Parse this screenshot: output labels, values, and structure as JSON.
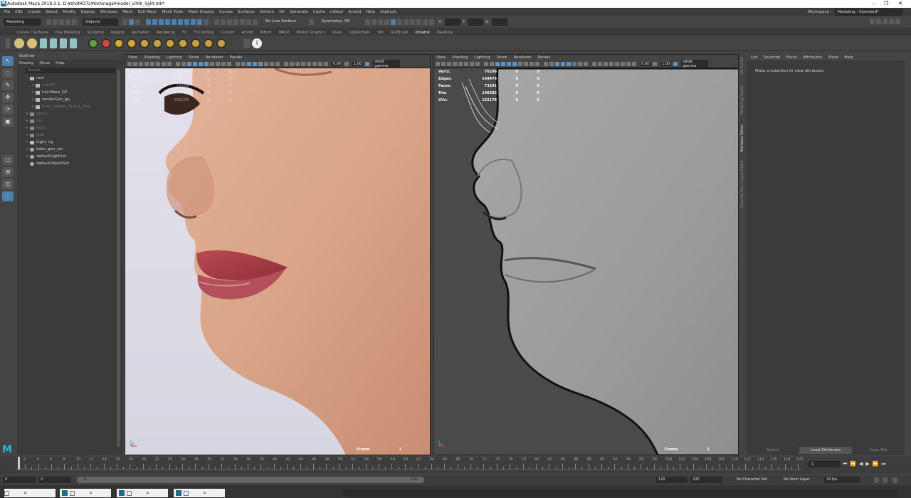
{
  "window": {
    "title": "Autodesk Maya 2019.3.1: D:¥shot¥DTL¥tominaga¥model_v006_light.mb*",
    "logo_letter": "M",
    "controls": [
      "–",
      "❐",
      "✕"
    ]
  },
  "menubar": {
    "items": [
      "File",
      "Edit",
      "Create",
      "Select",
      "Modify",
      "Display",
      "Windows",
      "Mesh",
      "Edit Mesh",
      "Mesh Tools",
      "Mesh Display",
      "Curves",
      "Surfaces",
      "Deform",
      "UV",
      "Generate",
      "Cache",
      "mGear",
      "Arnold",
      "Help",
      "chptools"
    ],
    "workspace_label": "Workspace :",
    "workspace_value": "Modeling - Standard*"
  },
  "statusline": {
    "mode": "Modeling",
    "objects": "Objects",
    "live_surface": "No Live Surface",
    "symmetry": "Symmetry: Off",
    "x_label": "X:",
    "y_label": "Y:",
    "z_label": "Z:"
  },
  "shelf": {
    "tabs": [
      "Curves / Surfaces",
      "Poly Modeling",
      "Sculpting",
      "Rigging",
      "Animation",
      "Rendering",
      "FX",
      "FX Caching",
      "Custom",
      "Arnold",
      "Bifrost",
      "MASH",
      "Motion Graphics",
      "XGen",
      "ngSkinTools",
      "Yeti",
      "GoZBrush",
      "Ornatrix",
      "Deadline"
    ],
    "active_tab": "Ornatrix",
    "icon_colors": [
      "#5ba53a",
      "#d14b3b",
      "#d8a82a",
      "#d8a82a",
      "#c9a23a",
      "#c9a23a",
      "#c9a23a",
      "#c9a23a",
      "#c9a23a",
      "#c9a23a",
      "#c9a23a"
    ]
  },
  "outliner": {
    "title": "Outliner",
    "menu": [
      "Display",
      "Show",
      "Help"
    ],
    "search_placeholder": "Search...",
    "nodes": [
      {
        "label": "root",
        "indent": 0,
        "type": "g",
        "dim": false,
        "expand": "−"
      },
      {
        "label": "hairGP",
        "indent": 1,
        "type": "g",
        "dim": true,
        "expand": "+"
      },
      {
        "label": "hairMake_GP",
        "indent": 1,
        "type": "g",
        "dim": false,
        "expand": "+"
      },
      {
        "label": "renderGeo_gp",
        "indent": 1,
        "type": "g",
        "dim": false,
        "expand": "+"
      },
      {
        "label": "body_render_target_dxg",
        "indent": 1,
        "type": "g",
        "dim": true,
        "expand": "+"
      },
      {
        "label": "persp",
        "indent": 0,
        "type": "cam",
        "dim": true,
        "expand": "+"
      },
      {
        "label": "top",
        "indent": 0,
        "type": "cam",
        "dim": true,
        "expand": "+"
      },
      {
        "label": "front",
        "indent": 0,
        "type": "cam",
        "dim": true,
        "expand": "+"
      },
      {
        "label": "side",
        "indent": 0,
        "type": "cam",
        "dim": true,
        "expand": "+"
      },
      {
        "label": "Light_rig",
        "indent": 0,
        "type": "g",
        "dim": false,
        "expand": "+"
      },
      {
        "label": "bake_geo_set",
        "indent": 0,
        "type": "set",
        "dim": false,
        "expand": "+"
      },
      {
        "label": "defaultLightSet",
        "indent": 0,
        "type": "set",
        "dim": false,
        "expand": "+"
      },
      {
        "label": "defaultObjectSet",
        "indent": 0,
        "type": "set",
        "dim": false,
        "expand": ""
      }
    ]
  },
  "viewport": {
    "menu": [
      "View",
      "Shading",
      "Lighting",
      "Show",
      "Renderer",
      "Panels"
    ],
    "exposure": "0.00",
    "gamma": "1.00",
    "colorspace": "sRGB gamma",
    "frame_label": "Frame:",
    "frame_value": "1"
  },
  "hud": {
    "rows": [
      {
        "k": "Verts:",
        "v": "76206",
        "a": "0",
        "b": "0"
      },
      {
        "k": "Edges:",
        "v": "149476",
        "a": "0",
        "b": "0"
      },
      {
        "k": "Faces:",
        "v": "73291",
        "a": "0",
        "b": "0"
      },
      {
        "k": "Tris:",
        "v": "146582",
        "a": "0",
        "b": "0"
      },
      {
        "k": "UVs:",
        "v": "152178",
        "a": "0",
        "b": "0"
      }
    ]
  },
  "attribute_editor": {
    "menu": [
      "List",
      "Selected",
      "Focus",
      "Attributes",
      "Show",
      "Help"
    ],
    "message": "Make a selection to view attributes",
    "buttons": [
      "Select",
      "Load Attributes",
      "Copy Tab"
    ],
    "side_tabs": [
      "UV Toolkit",
      "Modeling Toolkit",
      "Attribute Editor",
      "Channel Box / Layer Editor"
    ]
  },
  "timeslider": {
    "current_frame": "1",
    "play_buttons": [
      "⏮",
      "⏪",
      "◀",
      "▶",
      "⏩",
      "⏭"
    ]
  },
  "range": {
    "start": "0",
    "inner_start": "0",
    "bar_start": "0",
    "bar_end": "120",
    "inner_end": "120",
    "end": "200",
    "character_set": "No Character Set",
    "anim_layer": "No Anim Layer",
    "fps": "24 fps"
  },
  "taskbar": {
    "tasks": [
      "",
      "",
      "",
      ""
    ]
  }
}
